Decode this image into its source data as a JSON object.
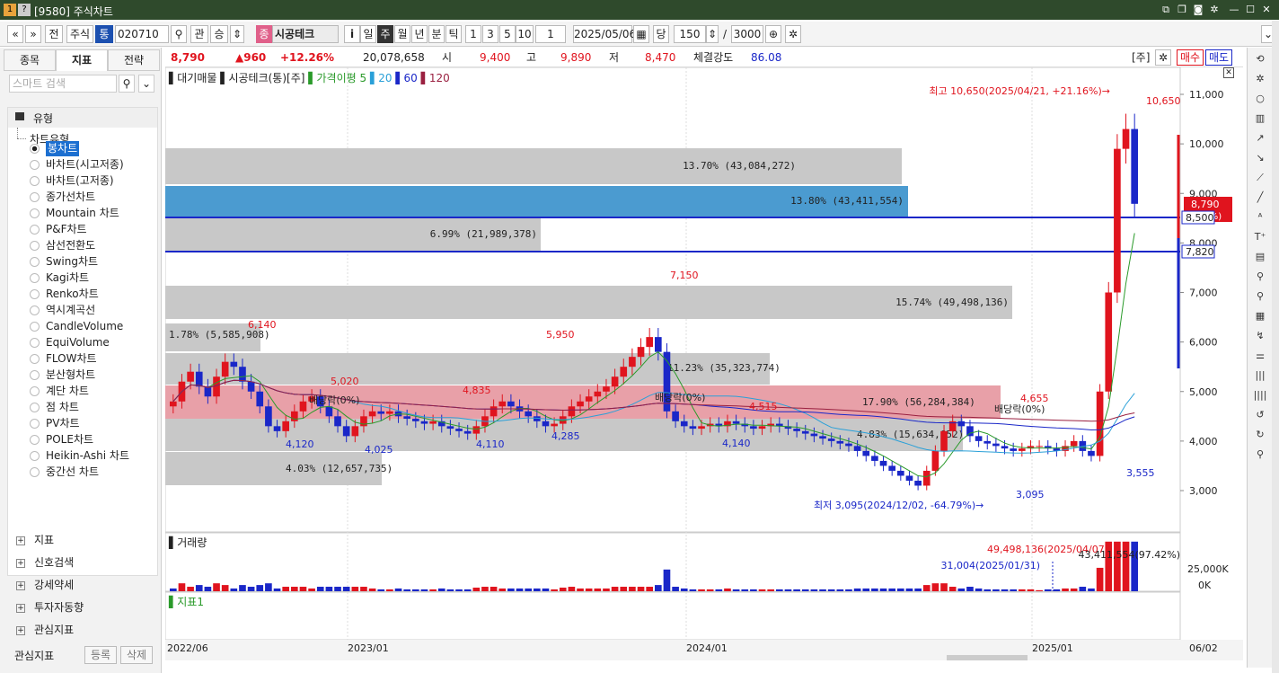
{
  "window": {
    "icon1": "1",
    "icon2": "?",
    "title": "[9580] 주식차트"
  },
  "toolbar": {
    "nav_prev": "«",
    "nav_down": "»",
    "btn_jeon": "전",
    "market": "주식",
    "type_badge": "통",
    "code": "020710",
    "btn_gwan": "관",
    "btn_sung": "승",
    "stock_badge": "종",
    "stock_name": "시공테크",
    "btn_i": "i",
    "periods": [
      "일",
      "주",
      "월",
      "년",
      "분",
      "틱"
    ],
    "active_period": "주",
    "nums": [
      "1",
      "3",
      "5",
      "10"
    ],
    "num_input": "1",
    "date": "2025/05/06",
    "btn_dang": "당",
    "count": "150",
    "slash": "/",
    "total": "3000"
  },
  "left": {
    "tabs": [
      "종목",
      "지표",
      "전략"
    ],
    "active_tab": "지표",
    "search_placeholder": "스마트 검색",
    "header": "유형",
    "group": "차트유형",
    "selected": "봉차트",
    "items": [
      "봉차트",
      "바차트(시고저종)",
      "바차트(고저종)",
      "종가선차트",
      "Mountain 차트",
      "P&F차트",
      "삼선전환도",
      "Swing차트",
      "Kagi차트",
      "Renko차트",
      "역시계곡선",
      "CandleVolume",
      "EquiVolume",
      "FLOW차트",
      "분산형차트",
      "계단 차트",
      "점 차트",
      "PV차트",
      "POLE차트",
      "Heikin-Ashi 차트",
      "중간선 차트"
    ],
    "groups": [
      "지표",
      "신호검색",
      "강세약세",
      "투자자동향",
      "관심지표"
    ],
    "bottom_label": "관심지표",
    "bottom_btn1": "등록",
    "bottom_btn2": "삭제"
  },
  "quote": {
    "price": "8,790",
    "change": "▲960",
    "rate": "+12.26%",
    "volume": "20,078,658",
    "open_label": "시",
    "open": "9,400",
    "high_label": "고",
    "high": "9,890",
    "low_label": "저",
    "low": "8,470",
    "strength_label": "체결강도",
    "strength": "86.08",
    "unit": "[주]",
    "buy": "매수",
    "sell": "매도"
  },
  "chart": {
    "legend": {
      "vp": "대기매물",
      "name": "시공테크(통)[주]",
      "ma_label": "가격이평",
      "ma": [
        "5",
        "20",
        "60",
        "120"
      ]
    },
    "y_ticks": [
      "11,000",
      "10,000",
      "9,000",
      "8,000",
      "7,000",
      "6,000",
      "5,000",
      "4,000",
      "3,000"
    ],
    "x_ticks": [
      "2022/06",
      "2023/01",
      "2024/01",
      "2025/01",
      "06/02"
    ],
    "high_note": "최고 10,650(2025/04/21, +21.16%)→",
    "low_note": "최저 3,095(2024/12/02, -64.79%)→",
    "price_tags": [
      "8,790",
      "8,500",
      "7,820"
    ],
    "tag_suffix": "26%)",
    "volume_title": "거래량",
    "vol_ticks": [
      "25,000K",
      "0K"
    ],
    "vol_note1": "49,498,136(2025/04/07)",
    "vol_note2": "31,004(2025/01/31)",
    "vol_note3": "43,411,554(97.42%)",
    "ind_title": "지표1",
    "labels": [
      "10,650",
      "7,150",
      "6,140",
      "5,950",
      "5,020",
      "4,835",
      "4,515",
      "4,655",
      "4,120",
      "4,025",
      "4,110",
      "4,285",
      "4,140",
      "3,095",
      "3,555"
    ],
    "vp_labels": [
      "13.70% (43,084,272)",
      "13.80% (43,411,554)",
      "6.99% (21,989,378)",
      "15.74% (49,498,136)",
      "1.78% (5,585,908)",
      "11.23% (35,323,774)",
      "17.90% (56,284,384)",
      "4.83% (15,634,652)",
      "4.03% (12,657,735)"
    ],
    "dividend": "배당락(0%)"
  },
  "colors": {
    "up": "#e0141e",
    "down": "#1a27c8",
    "vp_gray": "#c8c8c8",
    "vp_blue": "#4b9bd0",
    "vp_red": "#e8a0a8",
    "title_bar": "#2f4a2c"
  }
}
